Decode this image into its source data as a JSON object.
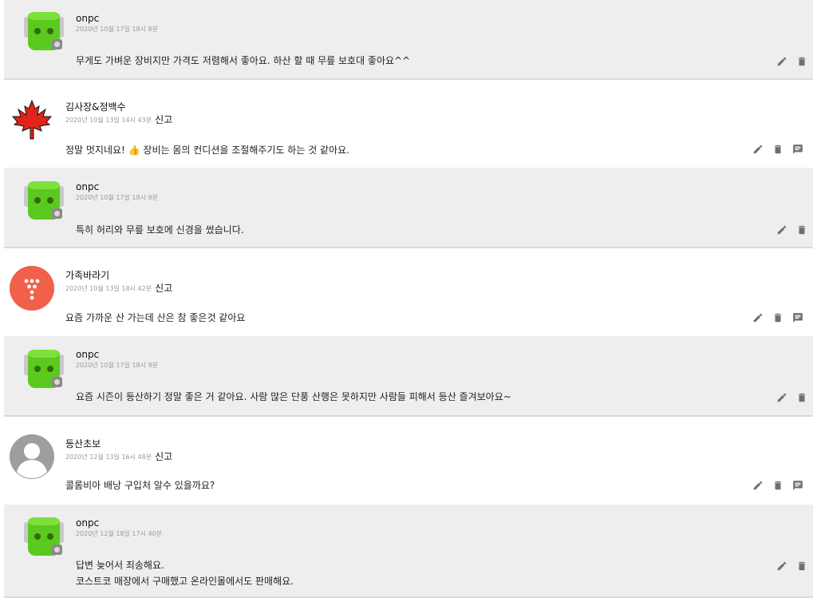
{
  "colors": {
    "reply_bg": "#eeeeee",
    "icon": "#6f6f6f",
    "meta": "#9a9a9a"
  },
  "report_label": "신고",
  "threads": [
    {
      "type": "reply",
      "author": "onpc",
      "timestamp": "2020년 10월 17일 18시 8분",
      "text": "무게도 가벼운 장비지만 가격도 저렴해서 좋아요. 하산 할 때 무릎 보호대 좋아요^^",
      "avatar": "robot-icon"
    },
    {
      "type": "comment",
      "author": "김사장&정백수",
      "timestamp": "2020년 10월 13일 14시 43분",
      "text": "정말 멋지네요! 👍 장비는 몸의 컨디션을 조절해주기도 하는 것 같아요.",
      "avatar": "maple-leaf-icon"
    },
    {
      "type": "reply",
      "author": "onpc",
      "timestamp": "2020년 10월 17일 18시 9분",
      "text": "특히 허리와 무릎 보호에 신경을 썼습니다.",
      "avatar": "robot-icon"
    },
    {
      "type": "comment",
      "author": "가족바라기",
      "timestamp": "2020년 10월 13일 18시 42분",
      "text": "요즘 가까운 산 가는데 산은 참 좋은것 같아요",
      "avatar": "red-dots-icon"
    },
    {
      "type": "reply",
      "author": "onpc",
      "timestamp": "2020년 10월 17일 18시 9분",
      "text": "요즘 시즌이 등산하기 정말 좋은 거 같아요. 사람 많은 단풍 산행은 못하지만 사람들 피해서 등산 즐겨보아요~",
      "avatar": "robot-icon"
    },
    {
      "type": "comment",
      "author": "등산초보",
      "timestamp": "2020년 12월 13일 16시 48분",
      "text": "콜롬비아 배낭 구입처 알수 있을까요?",
      "avatar": "default-user-icon"
    },
    {
      "type": "reply",
      "author": "onpc",
      "timestamp": "2020년 12월 18일 17시 40분",
      "text": "답변 늦어서 죄송해요.\n코스트코 매장에서 구매했고 온라인몰에서도 판매해요.",
      "avatar": "robot-icon"
    }
  ]
}
